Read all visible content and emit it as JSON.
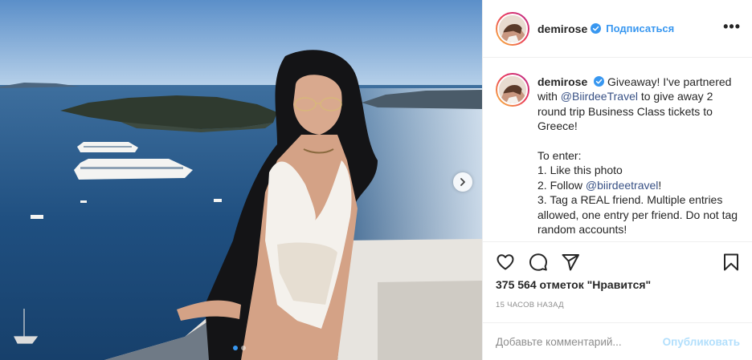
{
  "post": {
    "username": "demirose",
    "follow_label": "Подписаться",
    "more_label": "•••",
    "caption": {
      "intro": "Giveaway! I've partnered with",
      "mention_1": "@BiirdeeTravel",
      "intro_rest": "to give away 2 round trip Business Class tickets to Greece!",
      "enter_heading": "To enter:",
      "step_1": "1. Like this photo",
      "step_2_prefix": "2. Follow",
      "mention_2": "@biirdeetravel",
      "step_2_suffix": "!",
      "step_3": "3. Tag a REAL friend. Multiple entries allowed, one entry per friend. Do not tag random accounts!"
    },
    "likes_text": "375 564 отметок \"Нравится\"",
    "timestamp": "15 ЧАСОВ НАЗАД",
    "comment_placeholder": "Добавьте комментарий...",
    "publish_label": "Опубликовать"
  },
  "carousel": {
    "current_slide": 1,
    "total_slides": 2
  },
  "icons": {
    "verified": "verified-badge-icon",
    "like": "heart-outline-icon",
    "comment": "speech-bubble-icon",
    "share": "paper-plane-icon",
    "save": "bookmark-icon",
    "next": "chevron-right-icon"
  },
  "colors": {
    "link_blue": "#3897f0",
    "mention_blue": "#385185",
    "publish_disabled": "#b2dffc",
    "muted_text": "#8e8e8e",
    "border": "#efefef"
  }
}
